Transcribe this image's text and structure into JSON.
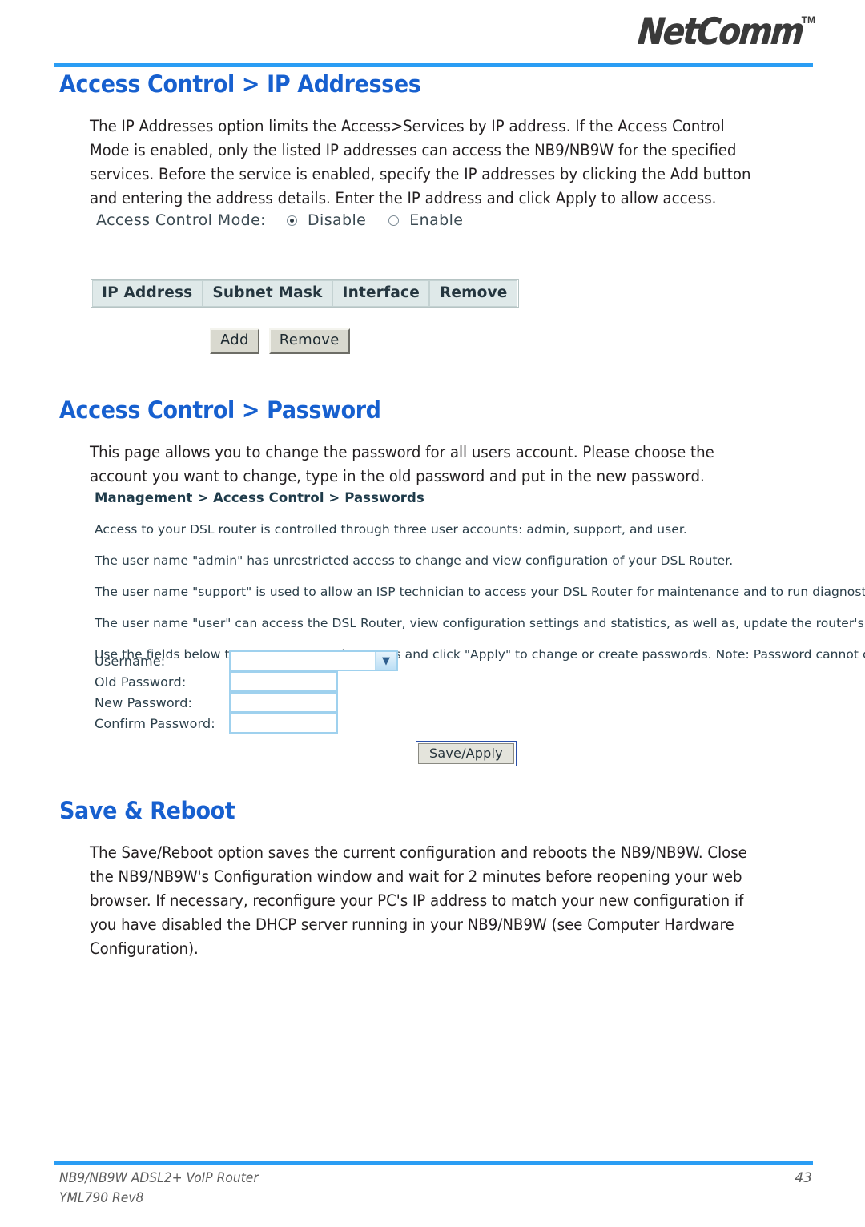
{
  "brand": {
    "logo_text": "NetComm",
    "trademark": "TM"
  },
  "sections": {
    "ip_addresses": {
      "heading": "Access Control > IP Addresses",
      "paragraph": "The IP Addresses option limits the Access>Services by IP address. If the Access Control Mode is enabled, only the listed IP addresses can access the NB9/NB9W for the specified services. Before the service is enabled, specify the IP addresses by clicking the Add button and entering the address details. Enter the IP address and click Apply to allow access.",
      "screenshot": {
        "access_control_mode_label": "Access Control Mode:",
        "options": [
          {
            "label": "Disable",
            "selected": true
          },
          {
            "label": "Enable",
            "selected": false
          }
        ],
        "table_headers": [
          "IP Address",
          "Subnet Mask",
          "Interface",
          "Remove"
        ],
        "buttons": [
          "Add",
          "Remove"
        ]
      }
    },
    "password": {
      "heading": "Access Control > Password",
      "paragraph": "This page allows you to change the password for all users account. Please choose the account you want to change, type in the old password and put in the new password.",
      "screenshot": {
        "breadcrumb": "Management > Access Control > Passwords",
        "lines": [
          "Access to your DSL router is controlled through three user accounts: admin, support, and user.",
          "The user name \"admin\" has unrestricted access to change and view configuration of your DSL Router.",
          "The user name \"support\" is used to allow an ISP technician to access your DSL Router for maintenance and to run diagnostics.",
          "The user name \"user\" can access the DSL Router, view configuration settings and statistics, as well as, update the router's software.",
          "Use the fields below to enter up to 16 characters and click \"Apply\" to change or create passwords. Note: Password cannot contain a space."
        ],
        "fields": [
          {
            "label": "Username:",
            "value": "",
            "type": "select"
          },
          {
            "label": "Old Password:",
            "value": "",
            "type": "password"
          },
          {
            "label": "New Password:",
            "value": "",
            "type": "password"
          },
          {
            "label": "Confirm Password:",
            "value": "",
            "type": "password"
          }
        ],
        "submit_label": "Save/Apply"
      }
    },
    "save_reboot": {
      "heading": "Save & Reboot",
      "paragraph": "The Save/Reboot option saves the current configuration and reboots the NB9/NB9W. Close the NB9/NB9W's Configuration window and wait for 2 minutes before reopening your web browser. If necessary, reconfigure your PC's IP address to match your new configuration if you have disabled the DHCP server running in your NB9/NB9W (see Computer Hardware Configuration)."
    }
  },
  "footer": {
    "product_line": "NB9/NB9W ADSL2+ VoIP Router",
    "revision_line": "YML790 Rev8",
    "page_number": "43"
  },
  "colors": {
    "heading_blue": "#1760cf",
    "rule_blue": "#2a9df4",
    "logo_gray": "#3a3a3a",
    "table_header_bg": "#dfe9e9",
    "field_border_blue": "#9fd1ee"
  }
}
